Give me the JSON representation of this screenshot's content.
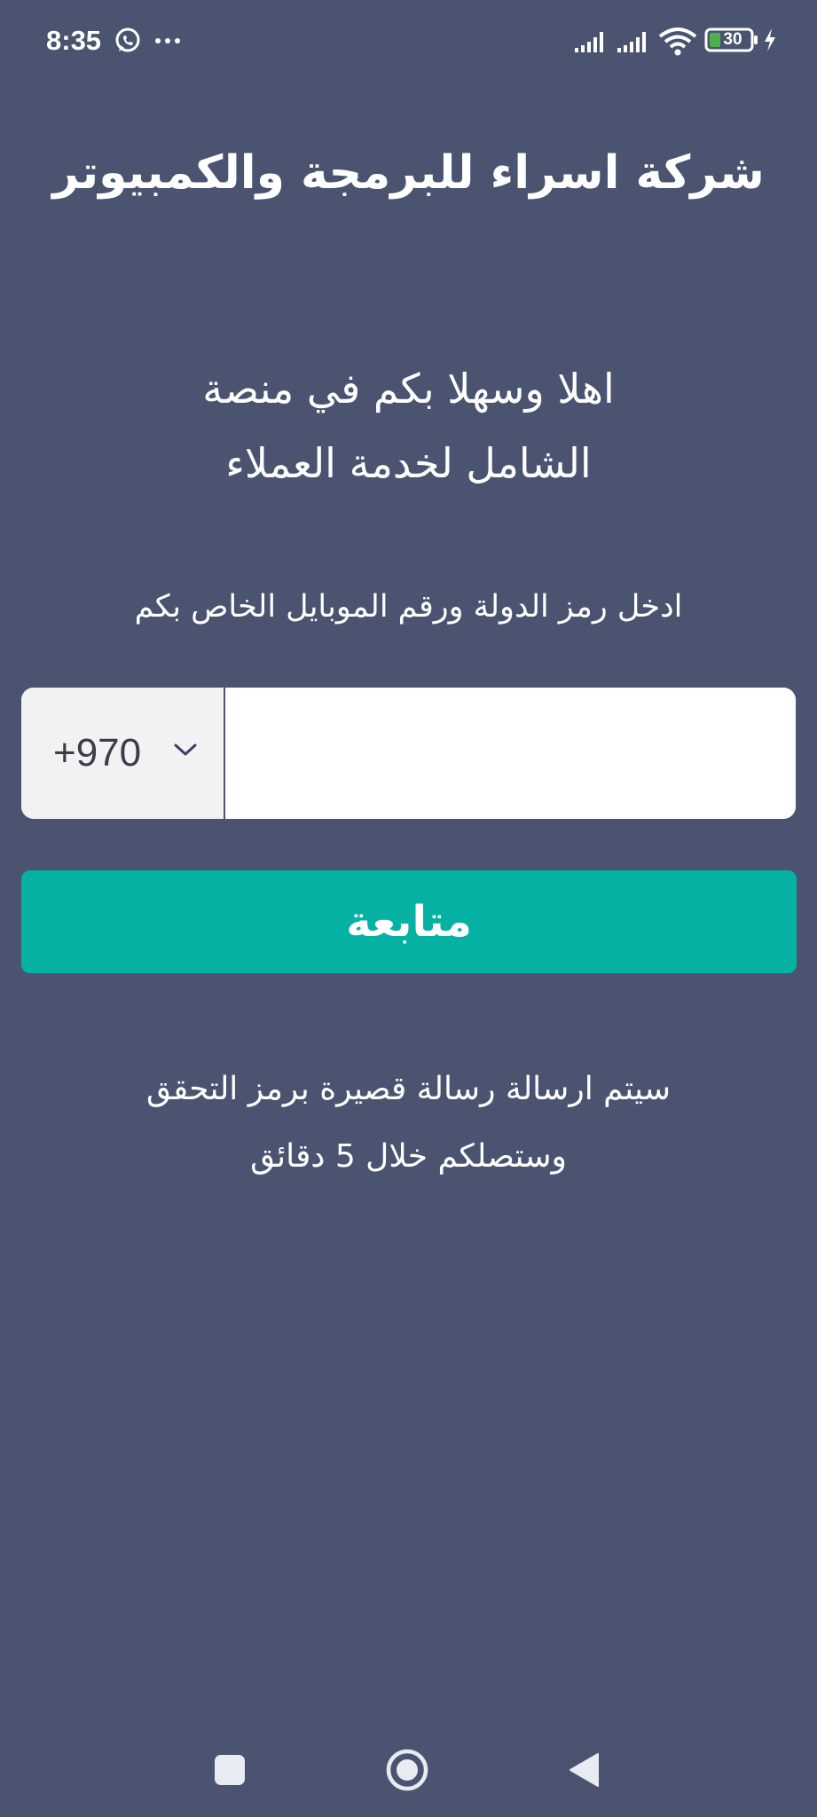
{
  "status_bar": {
    "time": "8:35",
    "battery_level": "30",
    "icons": [
      "whatsapp-icon",
      "more-icon",
      "signal-icon",
      "signal-icon",
      "wifi-icon",
      "battery-icon",
      "charging-icon"
    ]
  },
  "header": {
    "company_name": "شركة اسراء للبرمجة والكمبيوتر"
  },
  "welcome": {
    "line1": "اهلا وسهلا بكم في منصة",
    "line2": "الشامل لخدمة العملاء"
  },
  "form": {
    "instruction": "ادخل رمز الدولة ورقم الموبايل الخاص بكم",
    "country_code": "+970",
    "phone_value": "",
    "submit_label": "متابعة"
  },
  "note": {
    "line1": "سيتم ارسالة رسالة قصيرة برمز التحقق",
    "line2": "وستصلكم خلال 5 دقائق"
  },
  "colors": {
    "background": "#4a5470",
    "accent": "#05b1a3",
    "input_bg": "#ffffff",
    "selector_bg": "#f2f2f3"
  }
}
